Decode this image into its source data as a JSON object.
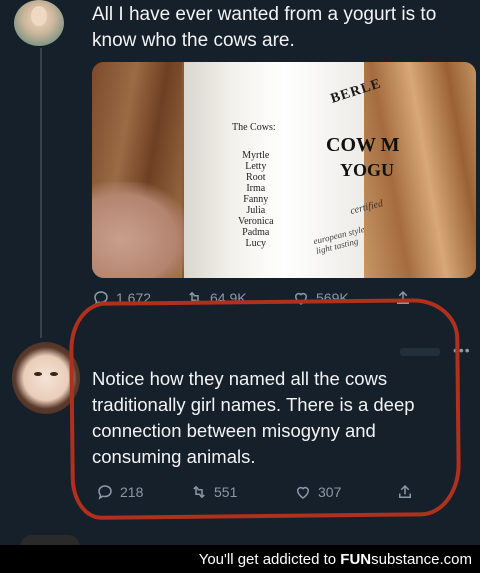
{
  "tweet1": {
    "text": "All I have ever wanted from a yogurt is to know who the cows are.",
    "media": {
      "cows_heading": "The Cows:",
      "cow_names": [
        "Myrtle",
        "Letty",
        "Root",
        "Irma",
        "Fanny",
        "Julia",
        "Veronica",
        "Padma",
        "Lucy"
      ],
      "brand_top": "BERLE",
      "brand_line1": "COW M",
      "brand_line2": "YOGU",
      "certified": "certified",
      "european_line1": "european style",
      "european_line2": "light tasting"
    },
    "replies": "1,672",
    "retweets": "64.9K",
    "likes": "569K"
  },
  "tweet2": {
    "more": "•••",
    "text": "Notice how they named all the cows traditionally girl names. There is a deep connection between misogyny and consuming animals.",
    "replies": "218",
    "retweets": "551",
    "likes": "307"
  },
  "annotation_color": "#b0301e",
  "footer": {
    "prefix": "You'll get addicted to ",
    "brand_bold": "FUN",
    "brand_rest": "substance.com"
  }
}
